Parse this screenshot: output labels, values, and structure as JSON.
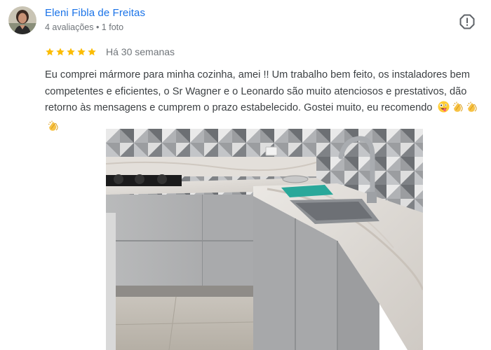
{
  "reviewer": {
    "name": "Eleni Fibla de Freitas",
    "meta": "4 avaliações • 1 foto",
    "avatar_icon": "user-avatar-photo"
  },
  "review": {
    "rating": 5,
    "rating_max": 5,
    "date": "Há 30 semanas",
    "text": "Eu comprei mármore para minha cozinha, amei !! Um trabalho bem feito, os instaladores bem competentes e eficientes, o Sr Wagner e o Leonardo são muito atenciosos e prestativos, dão retorno às mensagens e cumprem o prazo estabelecido. Gostei muito, eu recomendo",
    "emojis": [
      "zany-face-emoji",
      "clapping-hands-emoji",
      "clapping-hands-emoji",
      "clapping-hands-emoji"
    ]
  },
  "icons": {
    "more": "report-exclamation-icon",
    "star": "star-icon"
  },
  "colors": {
    "name_link": "#1a73e8",
    "secondary_text": "#70757a",
    "body_text": "#3c4043",
    "star": "#fbbc04"
  },
  "photo": {
    "subject": "kitchen-countertop-photo"
  }
}
